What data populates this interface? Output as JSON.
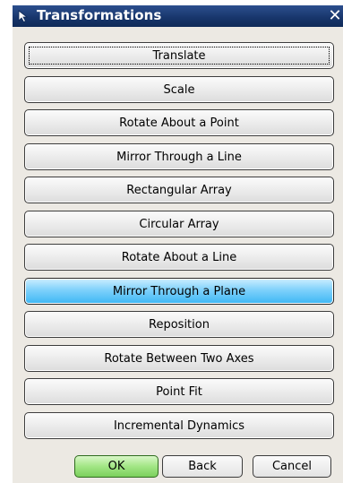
{
  "window": {
    "title": "Transformations",
    "close_label": "✕"
  },
  "options": [
    {
      "label": "Translate",
      "state": "focused"
    },
    {
      "label": "Scale",
      "state": "normal"
    },
    {
      "label": "Rotate About a Point",
      "state": "normal"
    },
    {
      "label": "Mirror Through a Line",
      "state": "normal"
    },
    {
      "label": "Rectangular Array",
      "state": "normal"
    },
    {
      "label": "Circular Array",
      "state": "normal"
    },
    {
      "label": "Rotate About a Line",
      "state": "normal"
    },
    {
      "label": "Mirror Through a Plane",
      "state": "active"
    },
    {
      "label": "Reposition",
      "state": "normal"
    },
    {
      "label": "Rotate Between Two Axes",
      "state": "normal"
    },
    {
      "label": "Point Fit",
      "state": "normal"
    },
    {
      "label": "Incremental Dynamics",
      "state": "normal"
    }
  ],
  "footer": {
    "ok_label": "OK",
    "back_label": "Back",
    "cancel_label": "Cancel"
  },
  "colors": {
    "titlebar": "#17356a",
    "active_option": "#5cc6f8",
    "ok_button": "#8fdc70"
  }
}
